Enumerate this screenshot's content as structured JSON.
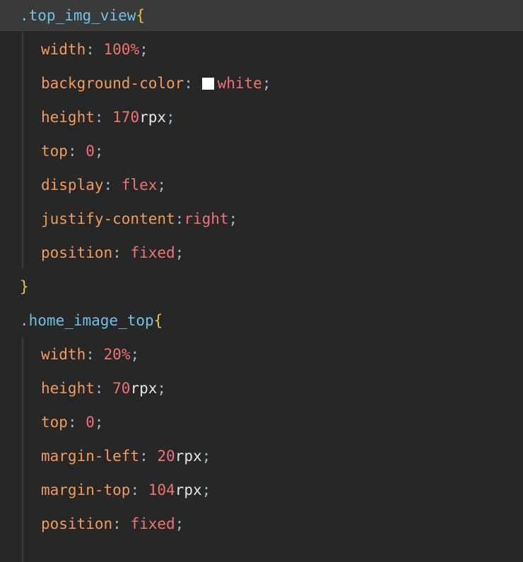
{
  "code": {
    "rule1": {
      "selector": ".top_img_view",
      "open_brace": "{",
      "close_brace": "}",
      "decls": [
        {
          "prop": "width",
          "colon": ": ",
          "num": "100",
          "unit": "",
          "kw": "%",
          "semi": ";"
        },
        {
          "prop": "background-color",
          "colon": ": ",
          "kw": "white",
          "semi": ";"
        },
        {
          "prop": "height",
          "colon": ": ",
          "num": "170",
          "unit": "rpx",
          "semi": ";"
        },
        {
          "prop": "top",
          "colon": ": ",
          "num": "0",
          "semi": ";"
        },
        {
          "prop": "display",
          "colon": ": ",
          "kw": "flex",
          "semi": ";"
        },
        {
          "prop": "justify-content",
          "colon": ":",
          "kw": "right",
          "semi": ";"
        },
        {
          "prop": "position",
          "colon": ": ",
          "kw": "fixed",
          "semi": ";"
        }
      ]
    },
    "rule2": {
      "selector": ".home_image_top",
      "open_brace": "{",
      "decls": [
        {
          "prop": "width",
          "colon": ": ",
          "num": "20",
          "kw": "%",
          "semi": ";"
        },
        {
          "prop": "height",
          "colon": ": ",
          "num": "70",
          "unit": "rpx",
          "semi": ";"
        },
        {
          "prop": "top",
          "colon": ": ",
          "num": "0",
          "semi": ";"
        },
        {
          "prop": "margin-left",
          "colon": ": ",
          "num": "20",
          "unit": "rpx",
          "semi": ";"
        },
        {
          "prop": "margin-top",
          "colon": ": ",
          "num": "104",
          "unit": "rpx",
          "semi": ";"
        },
        {
          "prop": "position",
          "colon": ": ",
          "kw": "fixed",
          "semi": ";"
        }
      ]
    },
    "swatch_color": "#ffffff"
  }
}
